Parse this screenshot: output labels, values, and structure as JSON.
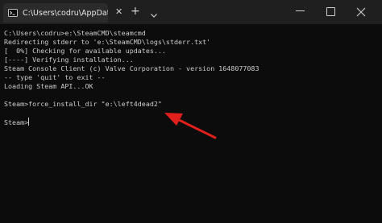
{
  "titlebar": {
    "tab_title": "C:\\Users\\codru\\AppData\\Roaming\\Microsoft",
    "icons": {
      "app": "terminal-icon",
      "close_tab": "close-icon",
      "new_tab": "plus-icon",
      "dropdown": "chevron-down-icon",
      "minimize": "minimize-icon",
      "maximize": "maximize-icon",
      "close_window": "close-icon"
    }
  },
  "terminal": {
    "lines": [
      "C:\\Users\\codru>e:\\SteamCMD\\steamcmd",
      "Redirecting stderr to 'e:\\SteamCMD\\logs\\stderr.txt'",
      "[  0%] Checking for available updates...",
      "[----] Verifying installation...",
      "Steam Console Client (c) Valve Corporation - version 1648077083",
      "-- type 'quit' to exit --",
      "Loading Steam API...OK"
    ],
    "command_prompt": "Steam>",
    "command_text": "force_install_dir \"e:\\left4dead2\"",
    "active_prompt": "Steam>"
  },
  "colors": {
    "background": "#0c0c0c",
    "titlebar": "#1f1f1f",
    "tab": "#2b2b2b",
    "text": "#cccccc",
    "arrow": "#e0201c"
  }
}
